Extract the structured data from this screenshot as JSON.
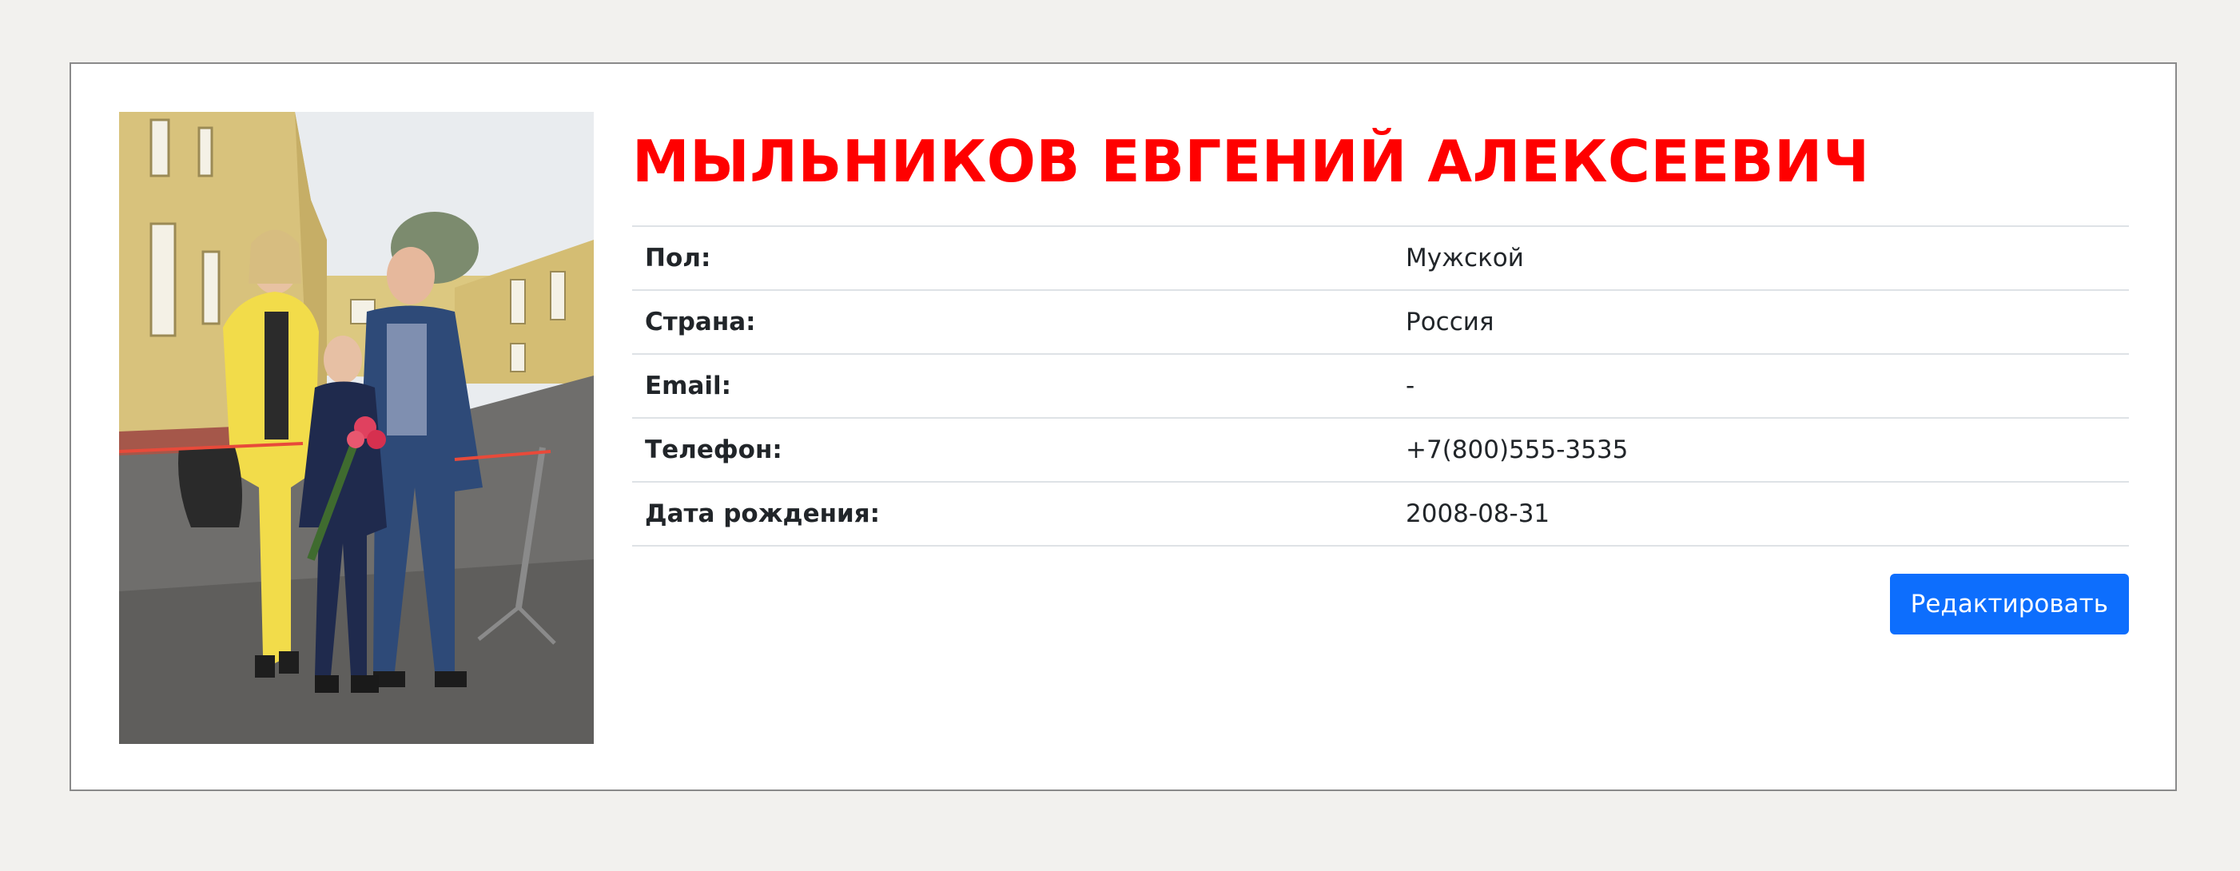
{
  "profile": {
    "full_name": "МЫЛЬНИКОВ ЕВГЕНИЙ АЛЕКСЕЕВИЧ",
    "photo_icon": "family-photo",
    "fields": [
      {
        "label": "Пол:",
        "value": "Мужской"
      },
      {
        "label": "Страна:",
        "value": "Россия"
      },
      {
        "label": "Email:",
        "value": "-"
      },
      {
        "label": "Телефон:",
        "value": "+7(800)555-3535"
      },
      {
        "label": "Дата рождения:",
        "value": "2008-08-31"
      }
    ],
    "edit_label": "Редактировать"
  },
  "colors": {
    "name": "#ff0000",
    "button": "#0d6efd",
    "background": "#f2f1ee"
  }
}
